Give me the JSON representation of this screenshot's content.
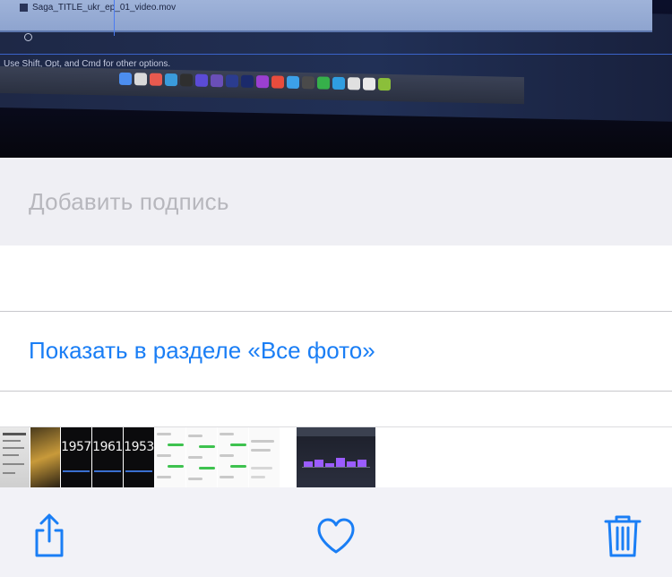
{
  "photo": {
    "clip_name": "Saga_TITLE_ukr_ep_01_video.mov",
    "hint_text": "Use Shift, Opt, and Cmd for other options."
  },
  "caption": {
    "placeholder": "Добавить подпись"
  },
  "show_all": {
    "label": "Показать в разделе «Все фото»"
  },
  "thumbnails": {
    "years": [
      "1957",
      "1961",
      "1953"
    ]
  },
  "toolbar": {
    "share_icon": "share-icon",
    "favorite_icon": "heart-icon",
    "delete_icon": "trash-icon"
  },
  "colors": {
    "accent": "#1a7ef5",
    "placeholder": "#b7b7bd",
    "background": "#f2f2f7"
  }
}
